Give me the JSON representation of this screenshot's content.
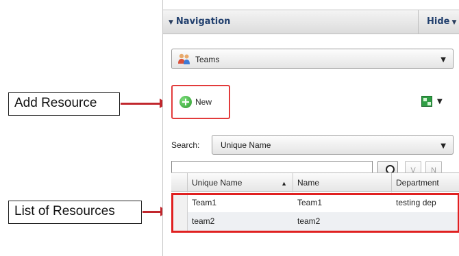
{
  "navigation": {
    "title": "Navigation",
    "hide_label": "Hide",
    "module_select": {
      "selected": "Teams",
      "icon": "people-icon"
    }
  },
  "toolbar": {
    "new_label": "New",
    "grid_icon": "grid-view-icon"
  },
  "search": {
    "label": "Search:",
    "field_select": "Unique Name",
    "input_value": "",
    "buttons": [
      "V",
      "N"
    ]
  },
  "table": {
    "columns": [
      "Unique Name",
      "Name",
      "Department"
    ],
    "rows": [
      [
        "Team1",
        "Team1",
        "testing dep"
      ],
      [
        "team2",
        "team2",
        ""
      ]
    ]
  },
  "callouts": {
    "add_resource": "Add Resource",
    "list_of_resources": "List of Resources"
  },
  "colors": {
    "highlight": "#e02020",
    "arrow": "#c1272d",
    "nav_text": "#22406e"
  }
}
